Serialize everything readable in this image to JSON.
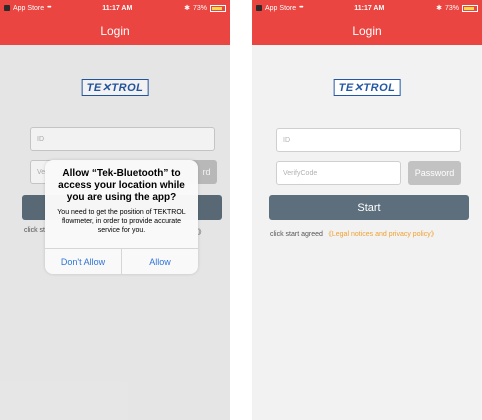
{
  "status": {
    "back_label": "App Store",
    "time": "11:17 AM",
    "battery": "73%"
  },
  "nav": {
    "title": "Login"
  },
  "logo": {
    "text": "TE✕TROL"
  },
  "left": {
    "id_placeholder": "ID",
    "verify_partial": "Veri",
    "password_partial": "rd",
    "agree_partial": "click st",
    "legal_partial": "》",
    "alert": {
      "title": "Allow “Tek-Bluetooth” to access your location while you are using the app?",
      "message": "You need to get the position of TEKTROL flowmeter, in order to provide accurate service for you.",
      "dont_allow": "Don't Allow",
      "allow": "Allow"
    }
  },
  "right": {
    "id_placeholder": "ID",
    "verify_placeholder": "VerifyCode",
    "password_button": "Password",
    "start_button": "Start",
    "agree_text": "click start agreed",
    "legal_link": "《Legal notices and privacy policy》"
  }
}
